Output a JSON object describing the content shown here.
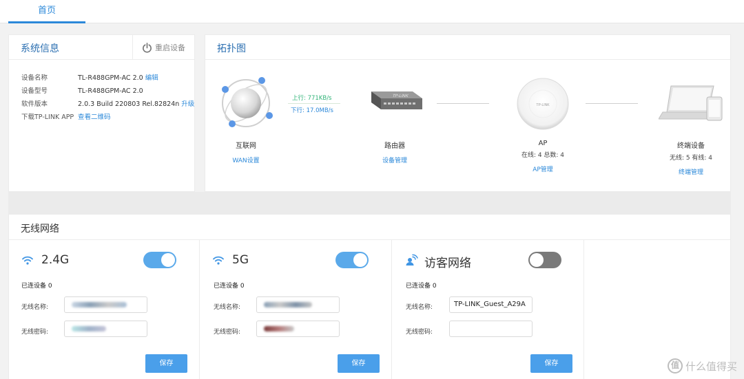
{
  "nav": {
    "home_tab": "首页"
  },
  "system": {
    "title": "系统信息",
    "reboot_label": "重启设备",
    "rows": [
      {
        "label": "设备名称",
        "value": "TL-R488GPM-AC 2.0",
        "link": "编辑"
      },
      {
        "label": "设备型号",
        "value": "TL-R488GPM-AC 2.0",
        "link": ""
      },
      {
        "label": "软件版本",
        "value": "2.0.3 Build 220803 Rel.82824n",
        "link": "升级"
      },
      {
        "label": "下载TP-LINK APP",
        "value": "",
        "link": "查看二维码"
      }
    ]
  },
  "topology": {
    "title": "拓扑图",
    "upload": "上行: 771KB/s",
    "download": "下行: 17.0MB/s",
    "internet": {
      "name": "互联网",
      "link": "WAN设置"
    },
    "router": {
      "name": "路由器",
      "link": "设备管理"
    },
    "ap": {
      "name": "AP",
      "status": "在线: 4 总数: 4",
      "link": "AP管理"
    },
    "terminal": {
      "name": "终端设备",
      "status": "无线: 5 有线: 4",
      "link": "终端管理"
    },
    "router_brand": "TP-LINK",
    "ap_brand": "TP-LINK"
  },
  "wireless": {
    "title": "无线网络",
    "cards": [
      {
        "band": "2.4G",
        "enabled": true,
        "connected": "已连设备 0",
        "ssid_label": "无线名称:",
        "ssid": "",
        "pwd_label": "无线密码:",
        "pwd": "",
        "save": "保存"
      },
      {
        "band": "5G",
        "enabled": true,
        "connected": "已连设备 0",
        "ssid_label": "无线名称:",
        "ssid": "",
        "pwd_label": "无线密码:",
        "pwd": "",
        "save": "保存"
      },
      {
        "band": "访客网络",
        "enabled": false,
        "connected": "已连设备 0",
        "ssid_label": "无线名称:",
        "ssid": "TP-LINK_Guest_A29A",
        "pwd_label": "无线密码:",
        "pwd": "",
        "save": "保存"
      }
    ]
  },
  "watermark": {
    "text": "什么值得买",
    "badge": "值"
  },
  "colors": {
    "accent": "#2b88d9",
    "toggle_on": "#5aa9ea",
    "toggle_off": "#7a7a7a",
    "button": "#4a9fea",
    "upload": "#2fb377"
  }
}
